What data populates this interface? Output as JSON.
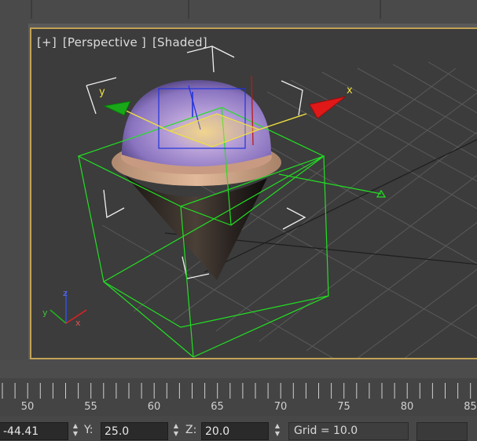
{
  "viewport": {
    "label_plus": "[+]",
    "label_view": "[Perspective ]",
    "label_shading": "[Shaded]",
    "gizmo_x": "x",
    "gizmo_y": "y",
    "axis_tripod": {
      "x": "x",
      "y": "y",
      "z": "z"
    }
  },
  "timeline": {
    "ticks": [
      "50",
      "55",
      "60",
      "65",
      "70",
      "75",
      "80",
      "85"
    ]
  },
  "status": {
    "x_value": "-44.41",
    "y_label": "Y:",
    "y_value": "25.0",
    "z_label": "Z:",
    "z_value": "20.0",
    "grid": "Grid = 10.0"
  },
  "colors": {
    "viewport_border": "#c2a255",
    "gizmo_x": "#e01818",
    "gizmo_y": "#18a818",
    "selection_box": "#22e022"
  }
}
